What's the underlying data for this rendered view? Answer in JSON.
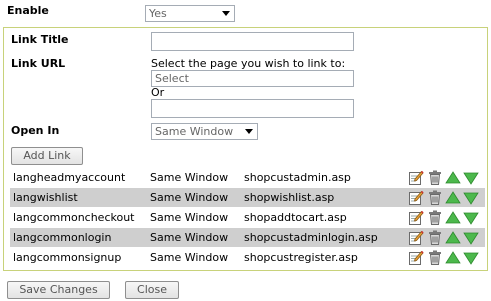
{
  "enable": {
    "label": "Enable",
    "value": "Yes"
  },
  "form": {
    "link_title_label": "Link Title",
    "link_url_label": "Link URL",
    "select_page_prompt": "Select the page you wish to link to:",
    "page_select_value": "Select",
    "or_text": "Or",
    "open_in_label": "Open In",
    "open_in_value": "Same Window",
    "add_link_label": "Add Link"
  },
  "links": [
    {
      "name": "langheadmyaccount",
      "target": "Same Window",
      "page": "shopcustadmin.asp"
    },
    {
      "name": "langwishlist",
      "target": "Same Window",
      "page": "shopwishlist.asp"
    },
    {
      "name": "langcommoncheckout",
      "target": "Same Window",
      "page": "shopaddtocart.asp"
    },
    {
      "name": "langcommonlogin",
      "target": "Same Window",
      "page": "shopcustadminlogin.asp"
    },
    {
      "name": "langcommonsignup",
      "target": "Same Window",
      "page": "shopcustregister.asp"
    }
  ],
  "row_actions": [
    "edit-icon",
    "trash-icon",
    "move-up-icon",
    "move-down-icon"
  ],
  "footer": {
    "save_label": "Save Changes",
    "close_label": "Close"
  },
  "colors": {
    "panel_border": "#c8d27a",
    "alt_row": "#cfcfcf",
    "arrow_green": "#4cb84c"
  }
}
